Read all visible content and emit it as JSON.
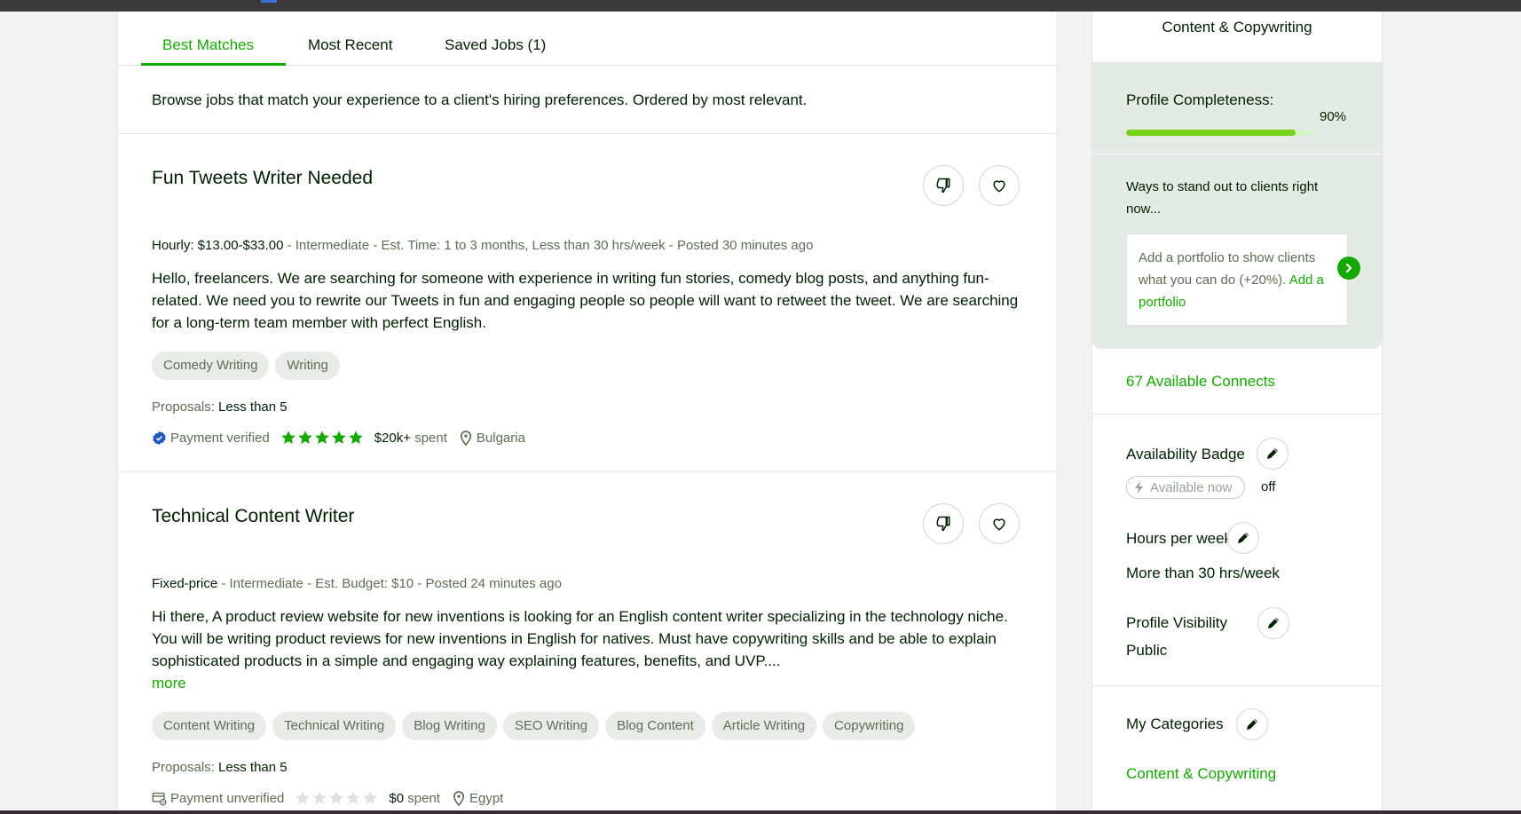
{
  "tabs": [
    {
      "label": "Best Matches",
      "active": true
    },
    {
      "label": "Most Recent",
      "active": false
    },
    {
      "label": "Saved Jobs (1)",
      "active": false
    }
  ],
  "intro": "Browse jobs that match your experience to a client's hiring preferences. Ordered by most relevant.",
  "jobs": [
    {
      "title": "Fun Tweets Writer Needed",
      "type": "Hourly: $13.00-$33.00",
      "details": " - Intermediate - Est. Time: 1 to 3 months, Less than 30 hrs/week - Posted ",
      "posted": "30 minutes ago",
      "description": "Hello, freelancers. We are searching for someone with experience in writing fun stories, comedy blog posts, and anything fun-related. We need you to rewrite our Tweets in fun and engaging people so people will want to retweet the tweet. We are searching for a long-term team member with perfect English.",
      "more": "",
      "skills": [
        "Comedy Writing",
        "Writing"
      ],
      "proposals_label": "Proposals:",
      "proposals_value": "Less than 5",
      "payment": "Payment verified",
      "payment_verified": true,
      "rating": 5,
      "spent_amount": "$20k+",
      "spent_label": "spent",
      "location": "Bulgaria"
    },
    {
      "title": "Technical Content Writer",
      "type": "Fixed-price",
      "details": " - Intermediate - Est. Budget: $10 - Posted ",
      "posted": "24 minutes ago",
      "description": "Hi there, A product review website for new inventions is looking for an English content writer specializing in the technology niche. You will be writing product reviews for new inventions in English for natives. Must have copywriting skills and be able to explain sophisticated products in a simple and engaging way explaining features, benefits, and UVP....",
      "more": "more",
      "skills": [
        "Content Writing",
        "Technical Writing",
        "Blog Writing",
        "SEO Writing",
        "Blog Content",
        "Article Writing",
        "Copywriting"
      ],
      "proposals_label": "Proposals:",
      "proposals_value": "Less than 5",
      "payment": "Payment unverified",
      "payment_verified": false,
      "rating": 0,
      "spent_amount": "$0",
      "spent_label": "spent",
      "location": "Egypt"
    }
  ],
  "sidebar": {
    "top_category": "Content & Copywriting",
    "completeness_label": "Profile Completeness:",
    "completeness_percent": "90%",
    "completeness_fraction": 0.9,
    "standout_text": "Ways to stand out to clients right now...",
    "portfolio_text": "Add a portfolio to show clients what you can do (+20%).",
    "portfolio_link": "Add a portfolio",
    "connects": "67 Available Connects",
    "availability_title": "Availability Badge",
    "availability_pill": "Available now",
    "availability_state": "off",
    "hours_title": "Hours per week",
    "hours_value": "More than 30 hrs/week",
    "visibility_title": "Profile Visibility",
    "visibility_value": "Public",
    "categories_title": "My Categories",
    "categories_value": "Content & Copywriting"
  },
  "colors": {
    "accent": "#14a800",
    "progress": "#73d11a",
    "verified": "#1f57c3"
  }
}
